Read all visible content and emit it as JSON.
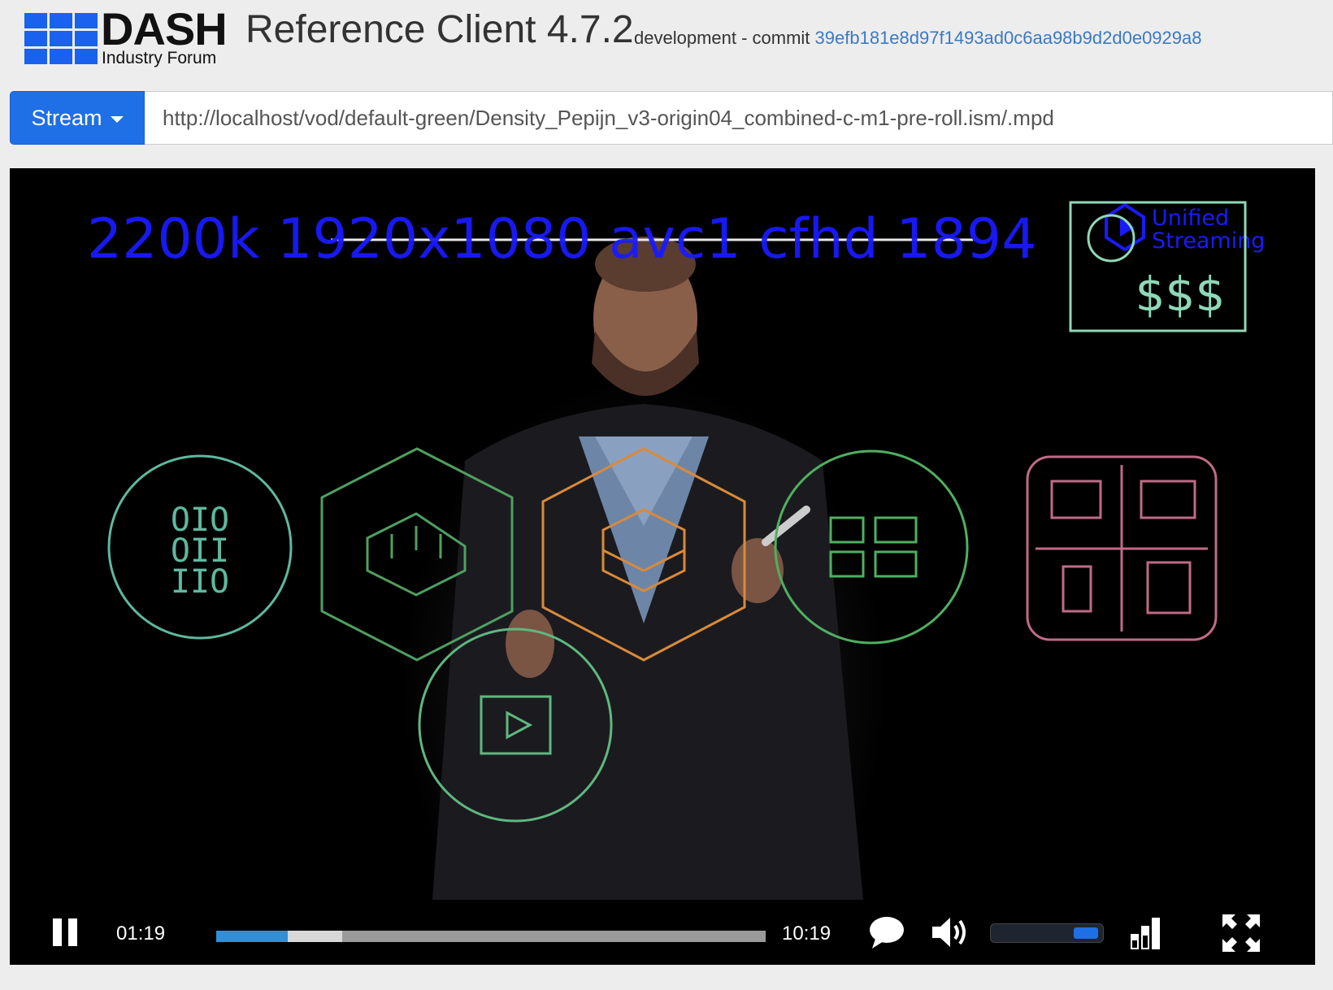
{
  "header": {
    "logo_title": "DASH",
    "logo_subtitle": "Industry Forum",
    "app_title": "Reference Client",
    "version": "4.7.2",
    "build_label": "development - commit",
    "commit_hash": "39efb181e8d97f1493ad0c6aa98b9d2d0e0929a8"
  },
  "stream": {
    "button_label": "Stream",
    "url": "http://localhost/vod/default-green/Density_Pepijn_v3-origin04_combined-c-m1-pre-roll.ism/.mpd"
  },
  "video": {
    "overlay_text": "2200k  1920x1080 avc1 cfhd 1894",
    "watermark_line1": "Unified",
    "watermark_line2": "Streaming",
    "handwritten_note": "$$$"
  },
  "controls": {
    "current_time": "01:19",
    "duration": "10:19",
    "played_fraction": 0.13,
    "buffered_fraction": 0.23,
    "volume_fraction": 0.85
  },
  "colors": {
    "accent": "#1f6fe6",
    "overlay_blue": "#1a1aff",
    "commit_link": "#3b7ac2",
    "played_bar": "#2f8fd8"
  }
}
